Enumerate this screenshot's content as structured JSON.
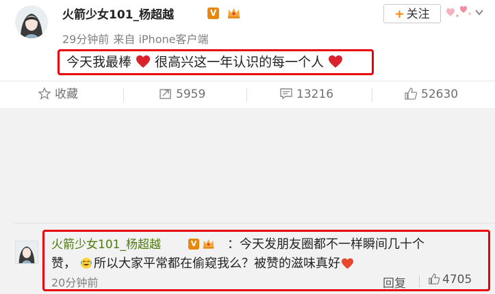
{
  "post": {
    "username": "火箭少女101_杨超越",
    "verified_badge": "V",
    "time": "29分钟前",
    "source": "来自 iPhone客户端",
    "follow_label": "关注",
    "follow_plus": "+",
    "text_part1": "今天我最棒",
    "text_part2": "很高兴这一年认识的每一个人",
    "icons": [
      "avatar",
      "v-badge",
      "crown-icon",
      "sticker-icon",
      "chevron-down-icon",
      "heart-icon"
    ]
  },
  "actions": {
    "favorite_label": "收藏",
    "repost_count": "5959",
    "comment_count": "13216",
    "like_count": "52630",
    "icons": [
      "star-icon",
      "repost-icon",
      "comment-icon",
      "thumbs-up-icon"
    ]
  },
  "comment": {
    "username": "火箭少女101_杨超越",
    "line1": "：今天发朋友圈都不一样瞬间几十个",
    "line2_start": "赞，",
    "line2_end": "所以大家平常都在偷窥我么？被赞的滋味真好",
    "time": "20分钟前",
    "reply_label": "回复",
    "like_count": "4705",
    "icons": [
      "emoji-icon",
      "heart-icon",
      "thumbs-up-icon"
    ]
  },
  "colors": {
    "highlight": "#e8000d",
    "comment_username": "#4d7b0a",
    "follow_plus": "#ff8200",
    "heart": "#d9222b",
    "badge": "#e8870e"
  }
}
